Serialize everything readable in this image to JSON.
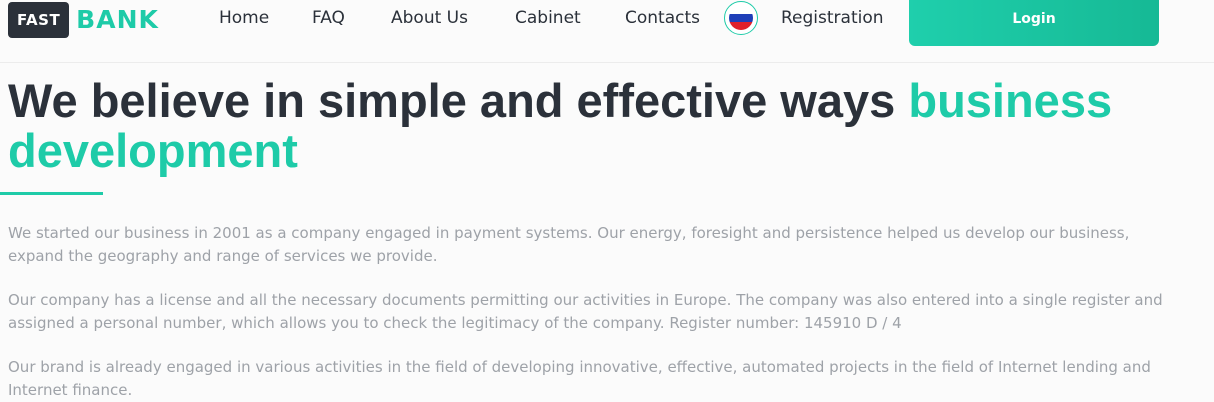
{
  "header": {
    "logo": {
      "badge": "FAST",
      "text": "BANK"
    },
    "nav": [
      {
        "label": "Home"
      },
      {
        "label": "FAQ"
      },
      {
        "label": "About Us"
      },
      {
        "label": "Cabinet"
      },
      {
        "label": "Contacts"
      },
      {
        "label": "Registration"
      }
    ],
    "language_icon": "russia-flag-icon",
    "login_label": "Login"
  },
  "hero": {
    "title_main": "We believe in simple and effective ways",
    "title_accent_1": "business",
    "title_accent_2": "development"
  },
  "content": {
    "paragraphs": [
      {
        "line1": "We started our business in 2001 as a company engaged in payment systems. Our energy, foresight and persistence helped us develop our business,",
        "line2": "expand the geography and range of services we provide."
      },
      {
        "line1": "Our company has a license and all the necessary documents permitting our activities in Europe. The company was also entered into a single register and",
        "line2": "assigned a personal number, which allows you to check the legitimacy of the company. Register number: 145910 D / 4"
      },
      {
        "line1": "Our brand is already engaged in various activities in the field of developing innovative, effective, automated projects in the field of Internet lending and",
        "line2": "Internet finance."
      }
    ]
  },
  "colors": {
    "accent": "#1ecba8",
    "dark": "#2b313a",
    "muted_text": "#9ea2a8",
    "background": "#fbfbfb"
  }
}
